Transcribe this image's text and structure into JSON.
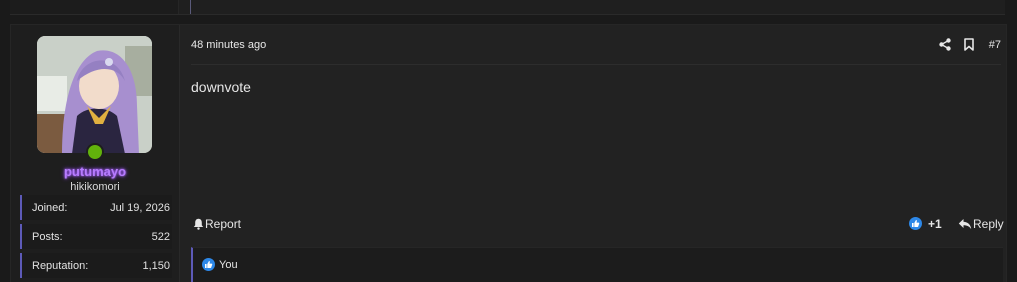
{
  "post": {
    "author": {
      "username": "putumayo",
      "user_title": "hikikomori",
      "online": true,
      "username_color": "#b77cff"
    },
    "stats": [
      {
        "label": "Joined:",
        "value": "Jul 19, 2026"
      },
      {
        "label": "Posts:",
        "value": "522"
      },
      {
        "label": "Reputation:",
        "value": "1,150"
      }
    ],
    "timestamp": "48 minutes ago",
    "post_number": "#7",
    "message": "downvote",
    "actions": {
      "report_label": "Report",
      "reaction_count": "+1",
      "reply_label": "Reply"
    },
    "reactions": {
      "reacted_by": "You"
    },
    "icons": {
      "share": "share-icon",
      "bookmark": "bookmark-icon",
      "report": "bell-icon",
      "reaction": "like-icon",
      "reply": "reply-icon"
    },
    "colors": {
      "accent": "#5d5ab8",
      "online": "#62b20c",
      "like_blue": "#2d88e8"
    }
  }
}
